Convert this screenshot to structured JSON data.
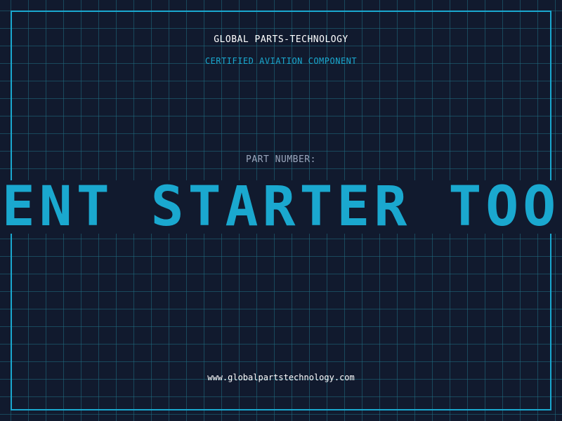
{
  "company": "GLOBAL PARTS-TECHNOLOGY",
  "subtitle": "CERTIFIED AVIATION COMPONENT",
  "part_label": "PART NUMBER:",
  "part_number": "DENT STARTER TOOL",
  "website": "www.globalpartstechnology.com",
  "colors": {
    "background": "#111a2e",
    "accent": "#1aa8cf",
    "grid": "#1f6e82",
    "label": "#9aa7bd",
    "text": "#ffffff"
  }
}
